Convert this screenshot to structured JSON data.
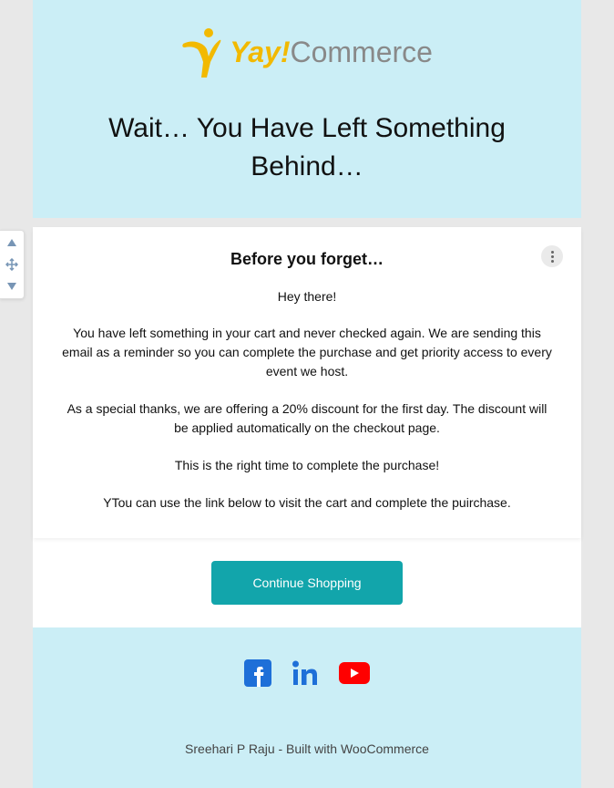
{
  "logo": {
    "yay": "Yay!",
    "commerce": "Commerce"
  },
  "header": {
    "title": "Wait… You Have Left Something Behind…"
  },
  "card": {
    "subtitle": "Before you forget…",
    "greeting": "Hey there!",
    "para1": "You have left something in your cart and never checked again. We are sending this email as a reminder so you can complete the purchase and get priority access to every event we host.",
    "para2": "As a special thanks, we are offering a 20% discount for the first day. The discount will be applied automatically on the checkout page.",
    "para3": "This is the right time to complete the purchase!",
    "para4": "YTou can use the link below to visit the cart and complete the puirchase."
  },
  "cta": {
    "label": "Continue Shopping"
  },
  "footer": {
    "credit": "Sreehari P Raju - Built with WooCommerce"
  }
}
